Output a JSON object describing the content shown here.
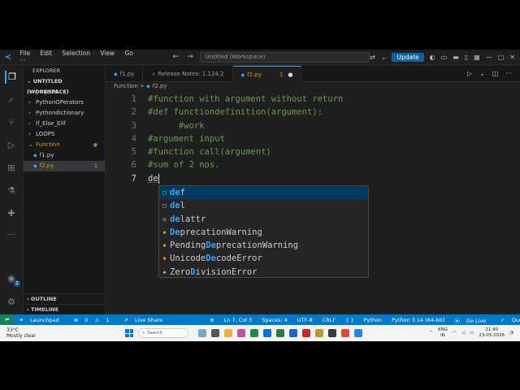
{
  "window": {
    "menu": [
      "File",
      "Edit",
      "Selection",
      "View",
      "Go"
    ],
    "more_menu": "···",
    "command_center": "Untitled (Workspace)",
    "update_label": "Update"
  },
  "activity_bar": {
    "account_badge": "1"
  },
  "sidebar": {
    "header": "EXPLORER",
    "workspace": "UNTITLED (WORKSPACE)",
    "folders": [
      "project1",
      "PythonOPerators",
      "Pythondictionary",
      "If_Else_Elif",
      "LOOPS"
    ],
    "open_folder": "Function",
    "files": [
      {
        "name": "f1.py",
        "badge": ""
      },
      {
        "name": "f2.py",
        "badge": "1"
      }
    ],
    "outline": "OUTLINE",
    "timeline": "TIMELINE"
  },
  "tabs": [
    {
      "label": "f1.py"
    },
    {
      "label": "Release Notes: 1.124.2"
    },
    {
      "label": "f2.py",
      "badge": "1"
    }
  ],
  "breadcrumb": {
    "folder": "Function",
    "sep": ">",
    "file": "f2.py"
  },
  "code": [
    {
      "n": "1",
      "text": "#function with argument without return"
    },
    {
      "n": "2",
      "text": "#def functiondefinition(argument):"
    },
    {
      "n": "3",
      "text": "      #work"
    },
    {
      "n": "4",
      "text": "#argument input"
    },
    {
      "n": "5",
      "text": "#function call(argument)"
    },
    {
      "n": "6",
      "text": "#sum of 2 nos."
    },
    {
      "n": "7",
      "text": "de"
    }
  ],
  "suggestions": [
    {
      "hl": "de",
      "rest": "f",
      "pre": "",
      "mid": "",
      "post": "",
      "icon": "□"
    },
    {
      "hl": "de",
      "rest": "l",
      "pre": "",
      "mid": "",
      "post": "",
      "icon": "□"
    },
    {
      "hl": "de",
      "rest": "lattr",
      "pre": "",
      "mid": "",
      "post": "",
      "icon": "◎"
    },
    {
      "hl": "De",
      "rest": "precationWarning",
      "pre": "",
      "mid": "",
      "post": "",
      "icon": "◆"
    },
    {
      "pre": "Pending",
      "mid": "De",
      "post": "precationWarning",
      "hl": "",
      "rest": "",
      "icon": "◆"
    },
    {
      "pre": "Unicode",
      "mid": "De",
      "post": "codeError",
      "hl": "",
      "rest": "",
      "icon": "◆"
    },
    {
      "pre": "Zero",
      "mid": "D",
      "post": "ivisionError",
      "hl": "",
      "rest": "",
      "icon": "◆"
    }
  ],
  "status": {
    "launchpad": "Launchpad",
    "errors": "0",
    "warnings": "1",
    "live_share": "Live Share",
    "position": "Ln 7, Col 3",
    "spaces": "Spaces: 4",
    "encoding": "UTF-8",
    "eol": "CRLF",
    "braces": "{ }",
    "language": "Python",
    "interpreter": "Python 3.14 (64-bit)",
    "go_live": "Go Live",
    "quokka": "Quokka"
  },
  "taskbar": {
    "temp": "33°C",
    "weather": "Mostly clear",
    "search": "Search",
    "lang": "ENG",
    "region": "IN",
    "time": "21:40",
    "date": "23-05-2026"
  }
}
